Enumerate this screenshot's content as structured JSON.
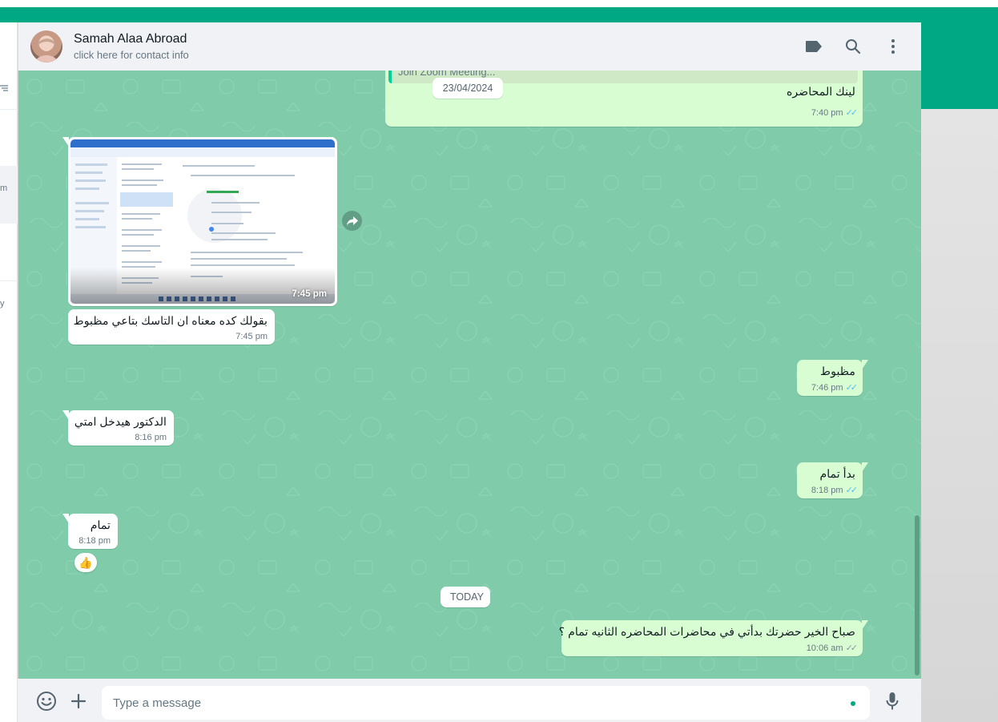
{
  "colors": {
    "accent": "#00a884",
    "chat_bg": "#7fcbaa",
    "bubble_in": "#ffffff",
    "bubble_out": "#d9fdd3",
    "read_ticks": "#53bdeb"
  },
  "sidebar_partial": {
    "selected_fragment": "m",
    "lower_fragment": "y"
  },
  "header": {
    "contact_name": "Samah Alaa Abroad",
    "contact_subtitle": "click here for contact info",
    "icons": [
      "label-icon",
      "search-icon",
      "menu-icon"
    ]
  },
  "messages": [
    {
      "id": "m1",
      "direction": "out",
      "quote": "Join Zoom Meeting...",
      "text": "لينك المحاضره",
      "time": "7:40 pm",
      "read": true
    },
    {
      "id": "m2",
      "direction": "in",
      "type": "image",
      "time": "7:45 pm"
    },
    {
      "id": "m3",
      "direction": "in",
      "text": "بقولك كده معناه ان التاسك بتاعي مظبوط",
      "time": "7:45 pm"
    },
    {
      "id": "m4",
      "direction": "out",
      "text": "مظبوط",
      "time": "7:46 pm",
      "read": true
    },
    {
      "id": "m5",
      "direction": "in",
      "text": "الدكتور هيدخل امتي",
      "time": "8:16 pm"
    },
    {
      "id": "m6",
      "direction": "out",
      "text": "بدأ تمام",
      "time": "8:18 pm",
      "read": true
    },
    {
      "id": "m7",
      "direction": "in",
      "text": "تمام",
      "time": "8:18 pm",
      "reaction": "👍"
    },
    {
      "id": "m8",
      "direction": "out",
      "text": "صباح الخير حضرتك بدأتي في محاضرات المحاضره الثانيه تمام ؟",
      "time": "10:06 am",
      "read": true
    }
  ],
  "date_chips": {
    "first": "23/04/2024",
    "today": "TODAY"
  },
  "footer": {
    "placeholder": "Type a message",
    "value": ""
  }
}
